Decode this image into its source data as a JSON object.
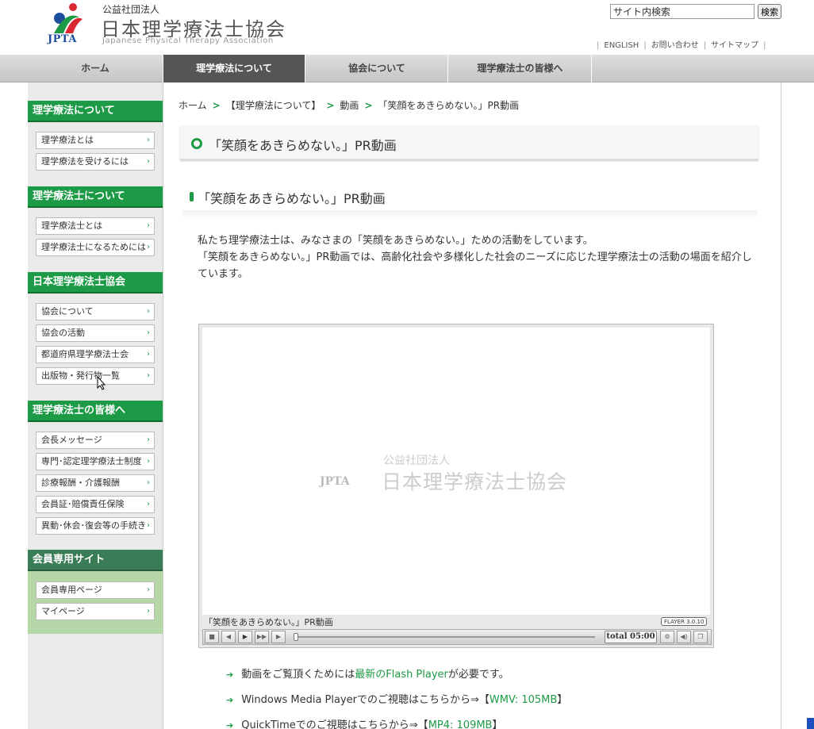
{
  "header": {
    "logo_text": "JPTA",
    "org_type": "公益社団法人",
    "org_name": "日本理学療法士協会",
    "org_name_en": "Japanese Physical Therapy Association",
    "search_placeholder": "サイト内検索",
    "search_button": "検索",
    "util_links": [
      "ENGLISH",
      "お問い合わせ",
      "サイトマップ"
    ]
  },
  "gnav": [
    "ホーム",
    "理学療法について",
    "協会について",
    "理学療法士の皆様へ"
  ],
  "sidebar": {
    "sections": [
      {
        "title": "理学療法について",
        "items": [
          "理学療法とは",
          "理学療法を受けるには"
        ]
      },
      {
        "title": "理学療法士について",
        "items": [
          "理学療法士とは",
          "理学療法士になるためには"
        ]
      },
      {
        "title": "日本理学療法士協会",
        "items": [
          "協会について",
          "協会の活動",
          "都道府県理学療法士会",
          "出版物・発行物一覧"
        ]
      },
      {
        "title": "理学療法士の皆様へ",
        "items": [
          "会長メッセージ",
          "専門･認定理学療法士制度",
          "診療報酬・介護報酬",
          "会員証･賠償責任保険",
          "異動･休会･復会等の手続き"
        ]
      },
      {
        "title": "会員専用サイト",
        "items": [
          "会員専用ページ",
          "マイページ"
        ]
      }
    ],
    "arrow": "›"
  },
  "breadcrumb": [
    "ホーム",
    "【理学療法について】",
    "動画",
    "「笑顔をあきらめない。」PR動画"
  ],
  "breadcrumb_sep": ">",
  "page_title": "「笑顔をあきらめない。」PR動画",
  "section_heading": "「笑顔をあきらめない。」PR動画",
  "intro": {
    "line1": "私たち理学療法士は、みなさまの「笑顔をあきらめない。」ための活動をしています。",
    "line2": "「笑顔をあきらめない。」PR動画では、高齢化社会や多様化した社会のニーズに応じた理学療法士の活動の場面を紹介しています。"
  },
  "player": {
    "logo_text": "JPTA",
    "org_type": "公益社団法人",
    "org_name": "日本理学療法士協会",
    "caption": "「笑顔をあきらめない。」PR動画",
    "version": "FLAYER 3.0.10",
    "total": "total 05:00",
    "progress": 0
  },
  "downloads": [
    {
      "pre": "動画をご覧頂くためには",
      "link": "最新のFlash Player",
      "post": "が必要です。"
    },
    {
      "pre": "Windows Media Playerでのご視聴はこちらから⇒【",
      "link": "WMV: 105MB",
      "post": "】"
    },
    {
      "pre": "QuickTimeでのご視聴はこちらから⇒【",
      "link": "MP4: 109MB",
      "post": "】"
    }
  ],
  "colors": {
    "accent": "#1c9a45",
    "nav_active": "#555555"
  }
}
